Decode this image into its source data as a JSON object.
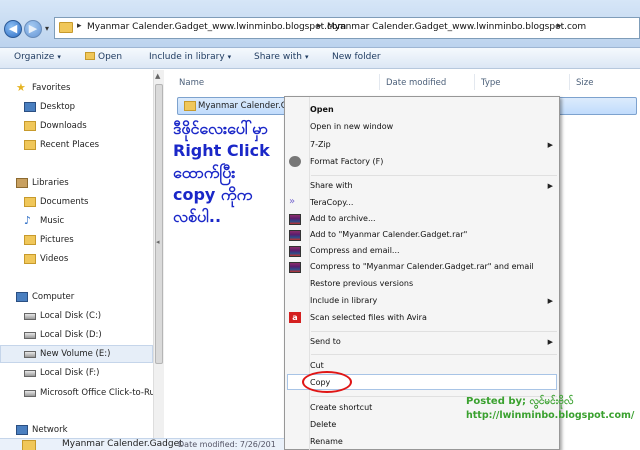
{
  "address": {
    "crumbs": [
      "Myanmar Calender.Gadget_www.lwinminbo.blogspot.com",
      "Myanmar Calender.Gadget_www.lwinminbo.blogspot.com"
    ],
    "separator": "▸"
  },
  "toolbar": {
    "organize": "Organize",
    "open": "Open",
    "include_in_library": "Include in library",
    "share_with": "Share with",
    "new_folder": "New folder",
    "arrow": "▾"
  },
  "nav": {
    "favorites": "Favorites",
    "desktop": "Desktop",
    "downloads": "Downloads",
    "recent_places": "Recent Places",
    "libraries": "Libraries",
    "documents": "Documents",
    "music": "Music",
    "pictures": "Pictures",
    "videos": "Videos",
    "computer": "Computer",
    "local_c": "Local Disk (C:)",
    "local_d": "Local Disk (D:)",
    "new_volume_e": "New Volume (E:)",
    "local_f": "Local Disk (F:)",
    "office": "Microsoft Office Click-to-Run",
    "network": "Network"
  },
  "columns": {
    "name": "Name",
    "date_modified": "Date modified",
    "type": "Type",
    "size": "Size"
  },
  "file": {
    "name": "Myanmar Calender.Gad"
  },
  "annotation": {
    "line1": "ဒီဖိုင်လေးပေါ်မှာ",
    "line2": "Right Click",
    "line3": "ထောက်ပြီး",
    "line4": "copy ကိုက",
    "line5": "လစ်ပါ.."
  },
  "menu": {
    "open": "Open",
    "open_new_window": "Open in new window",
    "seven_zip": "7-Zip",
    "format_factory": "Format Factory (F)",
    "share_with": "Share with",
    "teracopy": "TeraCopy...",
    "add_to_archive": "Add to archive...",
    "add_to_rar": "Add to \"Myanmar Calender.Gadget.rar\"",
    "compress_email": "Compress and email...",
    "compress_rar_email": "Compress to \"Myanmar Calender.Gadget.rar\" and email",
    "restore": "Restore previous versions",
    "include_library": "Include in library",
    "avira": "Scan selected files with Avira",
    "send_to": "Send to",
    "cut": "Cut",
    "copy": "Copy",
    "create_shortcut": "Create shortcut",
    "delete": "Delete",
    "rename": "Rename",
    "submenu_arrow": "▶"
  },
  "credits": {
    "posted": "Posted by; လွင်မင်းဗိုလ်",
    "url": "http://lwinminbo.blogspot.com/"
  },
  "details": {
    "name": "Myanmar Calender.Gadget",
    "date": "Date modified: 7/26/201"
  },
  "colors": {
    "annotation": "#1a27c8",
    "credits": "#3aa12f",
    "highlight_ring": "#e01515"
  }
}
